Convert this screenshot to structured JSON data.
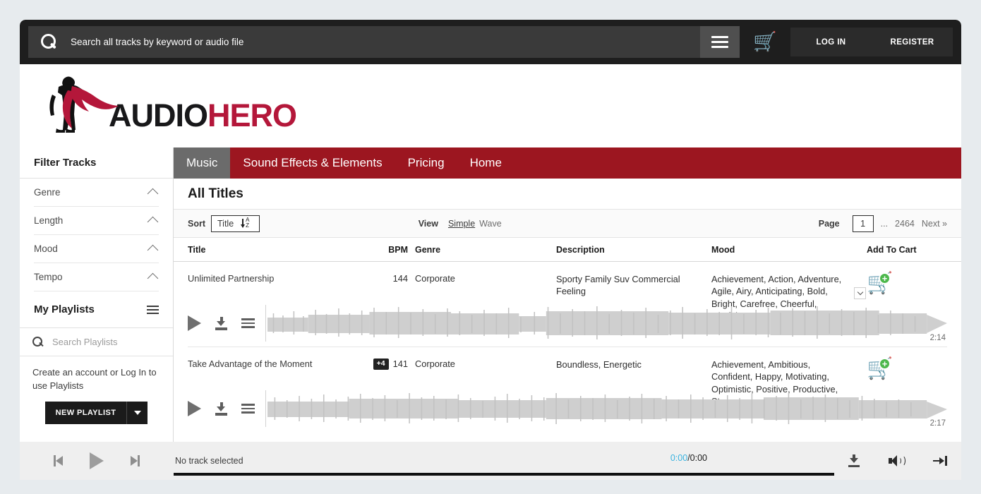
{
  "header": {
    "search_placeholder": "Search all tracks by keyword or audio file",
    "search_value": "",
    "menu_icon": "hamburger-icon",
    "cart_icon": "cart-icon",
    "login_label": "LOG IN",
    "register_label": "REGISTER"
  },
  "logo": {
    "word_first": "AUDIO",
    "word_second": "HERO",
    "mark": "superhero-silhouette-icon",
    "accent_color": "#b4173a"
  },
  "sidebar": {
    "filter_title": "Filter Tracks",
    "filters": [
      {
        "label": "Genre"
      },
      {
        "label": "Length"
      },
      {
        "label": "Mood"
      },
      {
        "label": "Tempo"
      }
    ],
    "playlists_title": "My Playlists",
    "playlist_search_placeholder": "Search Playlists",
    "playlist_search_value": "",
    "playlist_note": "Create an account or Log In to use Playlists",
    "new_playlist_label": "NEW PLAYLIST"
  },
  "nav": {
    "items": [
      {
        "label": "Music",
        "active": true
      },
      {
        "label": "Sound Effects & Elements",
        "active": false
      },
      {
        "label": "Pricing",
        "active": false
      },
      {
        "label": "Home",
        "active": false
      }
    ],
    "active_bg": "#6b6b6b",
    "bar_color": "#9c1620"
  },
  "page": {
    "title": "All Titles"
  },
  "toolbar": {
    "sort_label": "Sort",
    "sort_value": "Title",
    "sort_icon": "sort-a-z-icon",
    "view_label": "View",
    "view_simple": "Simple",
    "view_wave": "Wave",
    "page_label": "Page",
    "page_value": "1",
    "page_ellipsis": "...",
    "page_last": "2464",
    "next_label": "Next »"
  },
  "table": {
    "columns": [
      "Title",
      "BPM",
      "Genre",
      "Description",
      "Mood",
      "Add To Cart"
    ],
    "rows": [
      {
        "title": "Unlimited Partnership",
        "badge": "",
        "bpm": "144",
        "genre": "Corporate",
        "description": "Sporty Family Suv Commercial Feeling",
        "mood": "Achievement, Action, Adventure, Agile, Airy, Anticipating, Bold, Bright, Carefree, Cheerful, Confident,",
        "mood_has_more": true,
        "duration": "2:14",
        "cart_icon": "add-to-cart-icon"
      },
      {
        "title": "Take Advantage of the Moment",
        "badge": "+4",
        "bpm": "141",
        "genre": "Corporate",
        "description": "Boundless, Energetic",
        "mood": "Achievement, Ambitious, Confident, Happy, Motivating, Optimistic, Positive, Productive, Strong",
        "mood_has_more": false,
        "duration": "2:17",
        "cart_icon": "add-to-cart-icon"
      }
    ]
  },
  "player": {
    "track_label": "No track selected",
    "current_time": "0:00",
    "total_time": "/0:00",
    "current_time_color": "#39b3e0",
    "prev_icon": "skip-previous-icon",
    "play_icon": "play-icon",
    "next_icon": "skip-next-icon",
    "download_icon": "download-icon",
    "volume_icon": "volume-icon",
    "jump_icon": "jump-to-end-icon"
  }
}
